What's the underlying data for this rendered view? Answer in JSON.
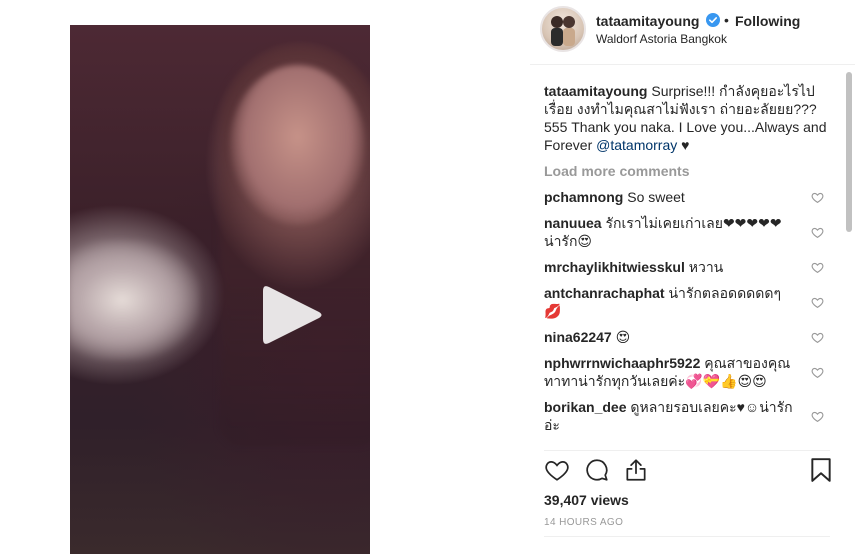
{
  "post": {
    "username": "tataamitayoung",
    "follow_status": "Following",
    "location": "Waldorf Astoria Bangkok",
    "caption": {
      "username": "tataamitayoung",
      "text": "Surprise!!! กำลังคุยอะไรไปเรื่อย งงทำไมคุณสาไม่ฟังเรา ถ่ายอะลัยยย??? 555 Thank you naka. I Love you...Always and Forever",
      "mention": "@tatamorray",
      "suffix": " ♥"
    },
    "load_more": "Load more comments",
    "comments": [
      {
        "user": "pchamnong",
        "text": "So sweet"
      },
      {
        "user": "nanuuea",
        "text": "รักเราไม่เคยเก่าเลย❤❤❤❤❤ น่ารัก😍"
      },
      {
        "user": "mrchaylikhitwiesskul",
        "text": "หวาน"
      },
      {
        "user": "antchanrachaphat",
        "text": "น่ารักตลอดดดดดๆ 💋"
      },
      {
        "user": "nina62247",
        "text": "😍"
      },
      {
        "user": "nphwrrnwichaaphr5922",
        "text": "คุณสาของคุณทาทาน่ารักทุกวันเลยค่ะ💞💝👍😍😍"
      },
      {
        "user": "borikan_dee",
        "text": "ดูหลายรอบเลยคะ♥☺น่ารักอ่ะ"
      }
    ],
    "views": "39,407 views",
    "time": "14 HOURS AGO"
  },
  "colors": {
    "text": "#262626",
    "muted": "#999999",
    "verified": "#3897f0",
    "mention": "#003569"
  },
  "icons": [
    "play-icon",
    "verified-badge-icon",
    "heart-icon",
    "comment-icon",
    "share-icon",
    "bookmark-icon"
  ]
}
